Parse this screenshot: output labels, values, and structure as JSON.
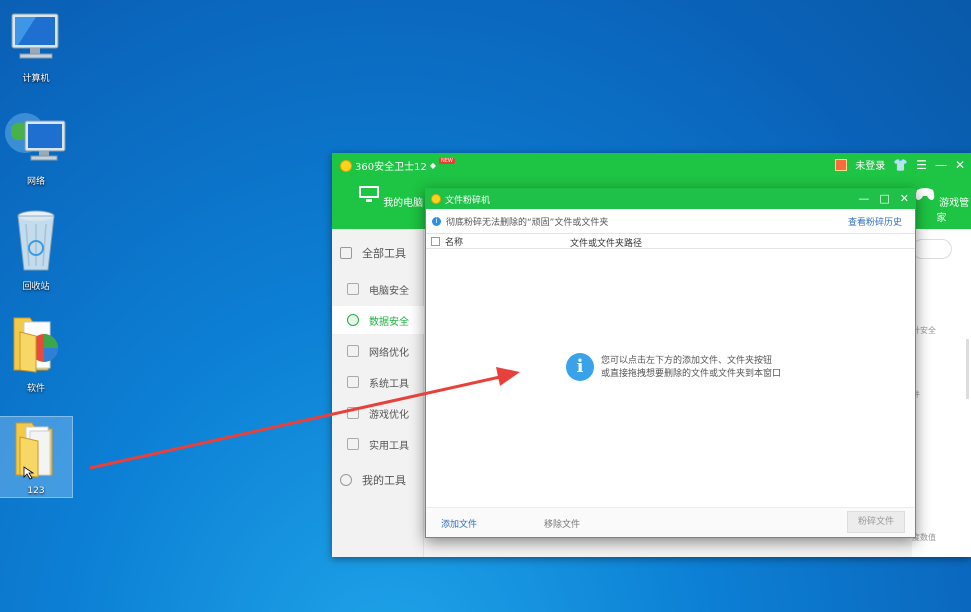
{
  "desktop": {
    "icons": [
      {
        "label": "计算机"
      },
      {
        "label": "网络"
      },
      {
        "label": "回收站"
      },
      {
        "label": "软件"
      },
      {
        "label": "123"
      }
    ]
  },
  "main_window": {
    "title": "360安全卫士12",
    "new_badge": "NEW",
    "login": "未登录",
    "controls": {
      "skin": "👕",
      "menu": "☰",
      "minimize": "—",
      "close": "✕"
    },
    "nav_tabs": [
      {
        "label": "我的电脑"
      },
      {
        "label": "游戏管家"
      }
    ],
    "sidebar": {
      "all_tools": "全部工具",
      "items": [
        {
          "label": "电脑安全"
        },
        {
          "label": "数据安全"
        },
        {
          "label": "网络优化"
        },
        {
          "label": "系统工具"
        },
        {
          "label": "游戏优化"
        },
        {
          "label": "实用工具"
        }
      ],
      "my_tools": "我的工具"
    },
    "right_text": [
      "计安全",
      "件",
      "度数值"
    ]
  },
  "shredder": {
    "title": "文件粉碎机",
    "controls": {
      "minimize": "—",
      "maximize": "□",
      "close": "✕"
    },
    "info": "彻底粉碎无法删除的“顽固”文件或文件夹",
    "history_link": "查看粉碎历史",
    "columns": {
      "name": "名称",
      "path": "文件或文件夹路径"
    },
    "empty_line1": "您可以点击左下方的添加文件、文件夹按钮",
    "empty_line2": "或直接拖拽想要删除的文件或文件夹到本窗口",
    "add_file": "添加文件",
    "remove_file": "移除文件",
    "shred_button": "粉碎文件"
  },
  "colors": {
    "accent_green": "#1ec443",
    "link_blue": "#2d6fc4",
    "arrow_red": "#e8403a"
  }
}
